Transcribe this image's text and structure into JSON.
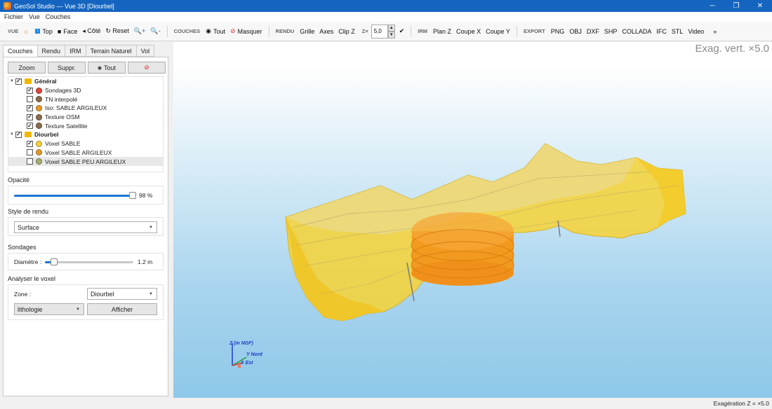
{
  "window": {
    "title": "GeoSol Studio — Vue 3D  [Diourbel]",
    "min": "─",
    "max": "❐",
    "close": "✕"
  },
  "menu": [
    "Fichier",
    "Vue",
    "Couches"
  ],
  "toolbar": {
    "vue_label": "VUE",
    "home_icon": "home-icon",
    "top": "Top",
    "face": "Face",
    "cote": "◂ Côté",
    "reset": "↻ Reset",
    "zoom_in": "🔍+",
    "zoom_out": "🔍-",
    "couches_label": "COUCHES",
    "tout": "Tout",
    "masquer": "Masquer",
    "rendu_label": "RENDU",
    "grille": "Grille",
    "axes": "Axes",
    "clipz": "Clip Z",
    "z_label": "Z×",
    "z_value": "5,0",
    "apply": "✔",
    "irm_label": "IRM",
    "planz": "Plan Z",
    "coupex": "Coupe X",
    "coupey": "Coupe Y",
    "export_label": "EXPORT",
    "png": "PNG",
    "obj": "OBJ",
    "dxf": "DXF",
    "shp": "SHP",
    "collada": "COLLADA",
    "ifc": "IFC",
    "stl": "STL",
    "video": "Video",
    "more": "»"
  },
  "tabs": [
    "Couches",
    "Rendu",
    "IRM",
    "Terrain Naturel",
    "Vol"
  ],
  "layer_buttons": {
    "zoom": "Zoom",
    "suppr": "Suppr.",
    "tout": "Tout",
    "none": "⊘"
  },
  "tree": [
    {
      "kind": "group",
      "label": "Général",
      "checked": true,
      "indent": 0
    },
    {
      "kind": "layer",
      "label": "Sondages 3D",
      "checked": true,
      "color": "#e0483a"
    },
    {
      "kind": "layer",
      "label": "TN interpolé",
      "checked": false,
      "color": "#8a6d4e"
    },
    {
      "kind": "layer",
      "label": "Iso: SABLE ARGILEUX",
      "checked": true,
      "color": "#e89a28"
    },
    {
      "kind": "layer",
      "label": "Texture OSM",
      "checked": true,
      "color": "#8a6d4e"
    },
    {
      "kind": "layer",
      "label": "Texture Satellite",
      "checked": true,
      "color": "#8a6d4e"
    },
    {
      "kind": "group",
      "label": "Diourbel",
      "checked": true,
      "indent": 0
    },
    {
      "kind": "layer",
      "label": "Voxel SABLE",
      "checked": true,
      "color": "#f5d33a"
    },
    {
      "kind": "layer",
      "label": "Voxel SABLE ARGILEUX",
      "checked": false,
      "color": "#e89a28"
    },
    {
      "kind": "layer",
      "label": "Voxel SABLE PEU ARGILEUX",
      "checked": false,
      "color": "#a6ad6e"
    }
  ],
  "opacity": {
    "label": "Opacité",
    "value": 0.98,
    "text": "98 %"
  },
  "render_style": {
    "label": "Style de rendu",
    "value": "Surface"
  },
  "boreholes": {
    "label": "Sondages",
    "diam_label": "Diamètre :",
    "value": 0.1,
    "text": "1.2 m"
  },
  "voxel": {
    "label": "Analyser le voxel",
    "zone_label": "Zone :",
    "zone_value": "Diourbel",
    "prop_value": "lithologie",
    "show": "Afficher"
  },
  "viewport": {
    "exag_label": "Exag. vert. ×5.0",
    "axis_z": "Z (m NGF)",
    "axis_y": "Y Nord",
    "axis_x": "X Est",
    "colors": {
      "volume": "#f5d33a",
      "iso": "#f29a1f",
      "sky_top": "#d8ecf7",
      "sky_bottom": "#8ec8e9"
    }
  },
  "status": "Exagération Z = ×5.0"
}
